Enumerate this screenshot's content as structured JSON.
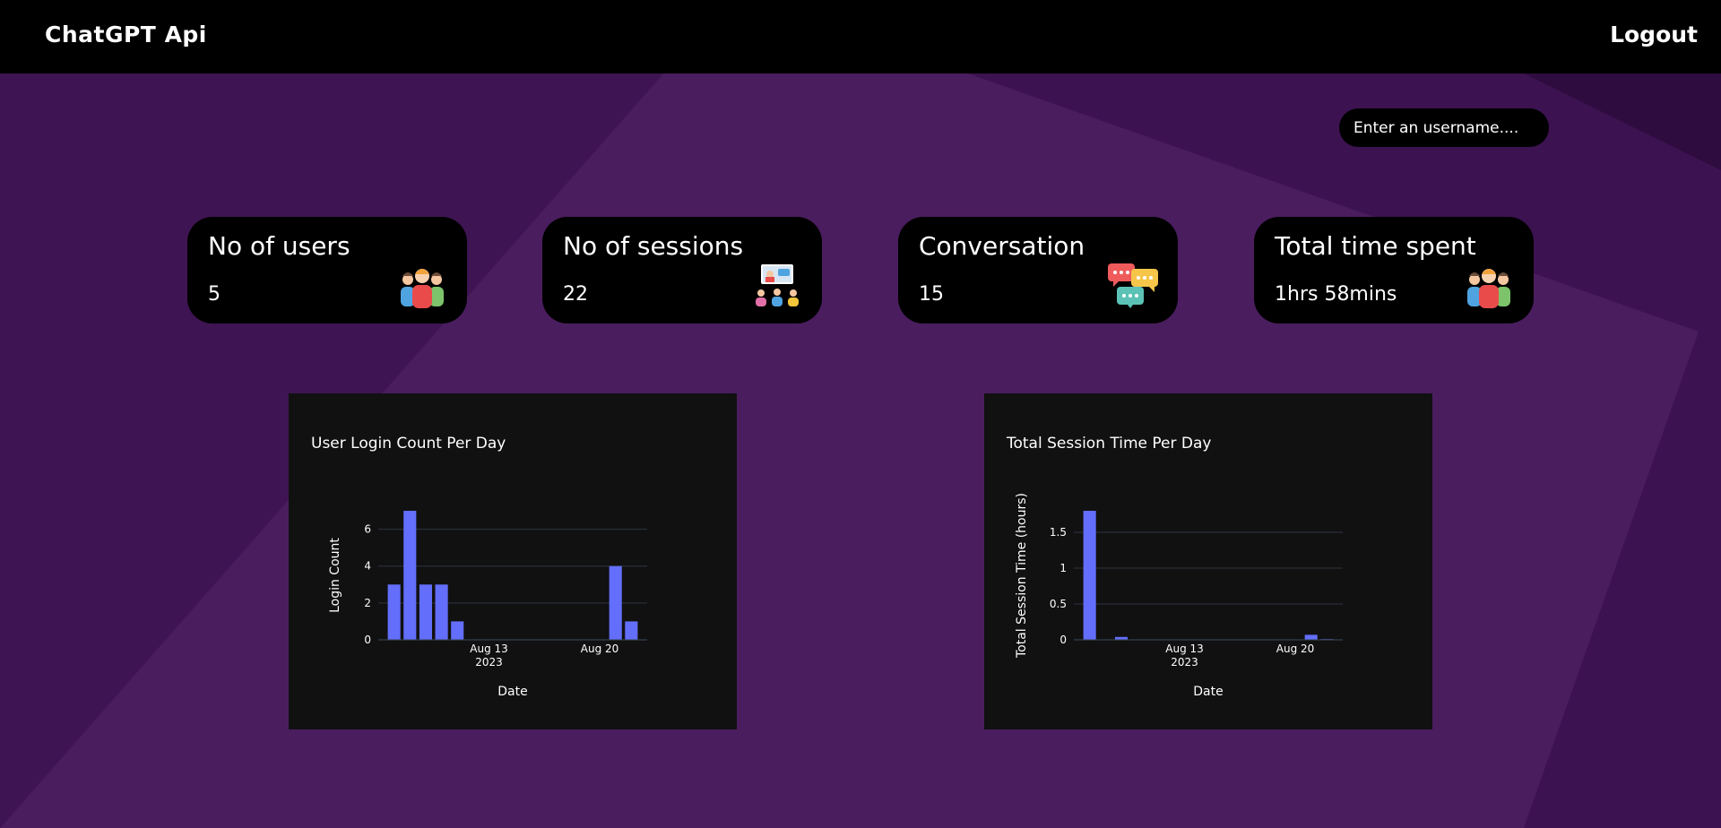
{
  "navbar": {
    "brand": "ChatGPT Api",
    "logout_label": "Logout"
  },
  "search": {
    "placeholder": "Enter an username...."
  },
  "cards": [
    {
      "title": "No of users",
      "value": "5",
      "icon": "users-group-icon"
    },
    {
      "title": "No of sessions",
      "value": "22",
      "icon": "video-meeting-icon"
    },
    {
      "title": "Conversation",
      "value": "15",
      "icon": "chat-bubbles-icon"
    },
    {
      "title": "Total time spent",
      "value": "1hrs 58mins",
      "icon": "users-group-icon"
    }
  ],
  "colors": {
    "background": "#3c1250",
    "bar": "#636efa",
    "panel": "#111111",
    "card": "#000000"
  },
  "chart_data": [
    {
      "type": "bar",
      "title": "User Login Count Per Day",
      "xlabel": "Date",
      "ylabel": "Login Count",
      "x": [
        "2023-08-07",
        "2023-08-08",
        "2023-08-09",
        "2023-08-10",
        "2023-08-11",
        "2023-08-21",
        "2023-08-22"
      ],
      "values": [
        3,
        7,
        3,
        3,
        1,
        4,
        1
      ],
      "x_range": [
        "2023-08-06",
        "2023-08-23"
      ],
      "ylim": [
        0,
        7
      ],
      "y_ticks": [
        "0",
        "2",
        "4",
        "6"
      ],
      "x_ticks": [
        {
          "date": "2023-08-13",
          "label": "Aug 13",
          "sublabel": "2023"
        },
        {
          "date": "2023-08-20",
          "label": "Aug 20",
          "sublabel": ""
        }
      ],
      "grid": true
    },
    {
      "type": "bar",
      "title": "Total Session Time Per Day",
      "xlabel": "Date",
      "ylabel": "Total Session Time (hours)",
      "x": [
        "2023-08-07",
        "2023-08-09",
        "2023-08-21",
        "2023-08-22"
      ],
      "values": [
        1.8,
        0.04,
        0.07,
        0.01
      ],
      "x_range": [
        "2023-08-06",
        "2023-08-23"
      ],
      "ylim": [
        0,
        1.8
      ],
      "y_ticks": [
        "0",
        "0.5",
        "1",
        "1.5"
      ],
      "x_ticks": [
        {
          "date": "2023-08-13",
          "label": "Aug 13",
          "sublabel": "2023"
        },
        {
          "date": "2023-08-20",
          "label": "Aug 20",
          "sublabel": ""
        }
      ],
      "grid": true
    }
  ]
}
